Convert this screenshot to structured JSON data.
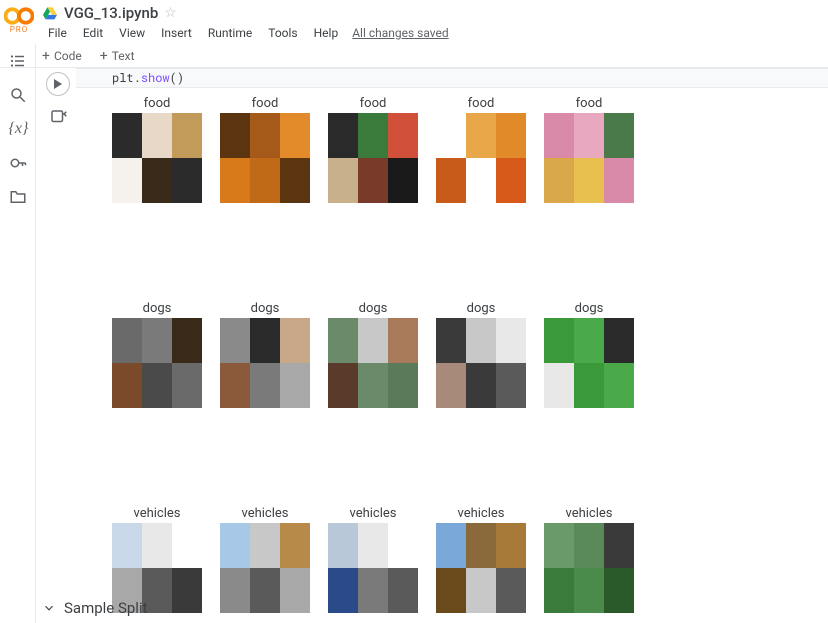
{
  "branding": {
    "pro_label": "PRO"
  },
  "header": {
    "notebook_title": "VGG_13.ipynb",
    "menus": [
      "File",
      "Edit",
      "View",
      "Insert",
      "Runtime",
      "Tools",
      "Help"
    ],
    "save_status": "All changes saved"
  },
  "toolbar": {
    "add_code": "Code",
    "add_text": "Text"
  },
  "code_cell": {
    "line_tokens": {
      "obj": "plt",
      "dot": ".",
      "fn": "show",
      "parens": "()"
    }
  },
  "output_grid": {
    "rows": [
      {
        "labels": [
          "food",
          "food",
          "food",
          "food",
          "food"
        ]
      },
      {
        "labels": [
          "dogs",
          "dogs",
          "dogs",
          "dogs",
          "dogs"
        ]
      },
      {
        "labels": [
          "vehicles",
          "vehicles",
          "vehicles",
          "vehicles",
          "vehicles"
        ]
      }
    ]
  },
  "section_heading": {
    "title": "Sample Split"
  },
  "swatches": {
    "food": [
      [
        "#2b2b2b",
        "#e8d8c8",
        "#c29a5a",
        "#f5f2ee",
        "#3a2a1a",
        "#2b2b2b"
      ],
      [
        "#5a3510",
        "#a55a1a",
        "#e38a2a",
        "#d87a1a",
        "#c06a18",
        "#5a3510"
      ],
      [
        "#2a2a2a",
        "#3a7a3a",
        "#d0503a",
        "#c8b08a",
        "#7a3a2a",
        "#1a1a1a"
      ],
      [
        "#ffffff",
        "#e8a84a",
        "#e08a2a",
        "#c85a1a",
        "#ffffff",
        "#d85a1a"
      ],
      [
        "#d88aa8",
        "#e8a8c0",
        "#4a7a4a",
        "#d8a84a",
        "#e8c050",
        "#d88aa8"
      ]
    ],
    "dogs": [
      [
        "#6a6a6a",
        "#7a7a7a",
        "#3a2a1a",
        "#7a4a2a",
        "#4a4a4a",
        "#6a6a6a"
      ],
      [
        "#8a8a8a",
        "#2a2a2a",
        "#c8a888",
        "#8a5a3a",
        "#7a7a7a",
        "#a8a8a8"
      ],
      [
        "#6a8a6a",
        "#c8c8c8",
        "#a87a5a",
        "#5a3a2a",
        "#6a8a6a",
        "#5a7a5a"
      ],
      [
        "#3a3a3a",
        "#c8c8c8",
        "#e8e8e8",
        "#a88a7a",
        "#3a3a3a",
        "#5a5a5a"
      ],
      [
        "#3a9a3a",
        "#4aaa4a",
        "#2a2a2a",
        "#e8e8e8",
        "#3a9a3a",
        "#4aaa4a"
      ]
    ],
    "vehicles": [
      [
        "#c8d8e8",
        "#e8e8e8",
        "#ffffff",
        "#a8a8a8",
        "#5a5a5a",
        "#3a3a3a"
      ],
      [
        "#a8c8e8",
        "#c8c8c8",
        "#b88a4a",
        "#8a8a8a",
        "#5a5a5a",
        "#a8a8a8"
      ],
      [
        "#b8c8d8",
        "#e8e8e8",
        "#ffffff",
        "#2a4a8a",
        "#7a7a7a",
        "#5a5a5a"
      ],
      [
        "#7aa8d8",
        "#8a6a3a",
        "#a87a3a",
        "#6a4a1a",
        "#c8c8c8",
        "#5a5a5a"
      ],
      [
        "#6a9a6a",
        "#5a8a5a",
        "#3a3a3a",
        "#3a7a3a",
        "#4a8a4a",
        "#2a5a2a"
      ]
    ]
  }
}
